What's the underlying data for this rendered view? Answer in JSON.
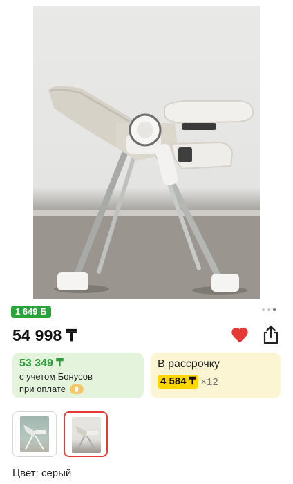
{
  "product": {
    "bonus_badge": "1 649 Б",
    "price": "54 998 ₸",
    "gallery": {
      "total": 3,
      "active_index": 2
    },
    "icons": {
      "favorite": "heart-icon",
      "share": "share-icon",
      "payment": "kaspi-icon"
    },
    "colors": {
      "heart": "#e53935",
      "bonus_green": "#2aa33b",
      "install_yellow": "#ffd600"
    }
  },
  "bonus_card": {
    "amount": "53 349 ₸",
    "line1": "с учетом Бонусов",
    "line2": "при оплате"
  },
  "installment_card": {
    "title": "В рассрочку",
    "amount": "4 584 ₸",
    "times": "×12"
  },
  "variants": {
    "selected": 1,
    "color_label": "Цвет: серый"
  }
}
